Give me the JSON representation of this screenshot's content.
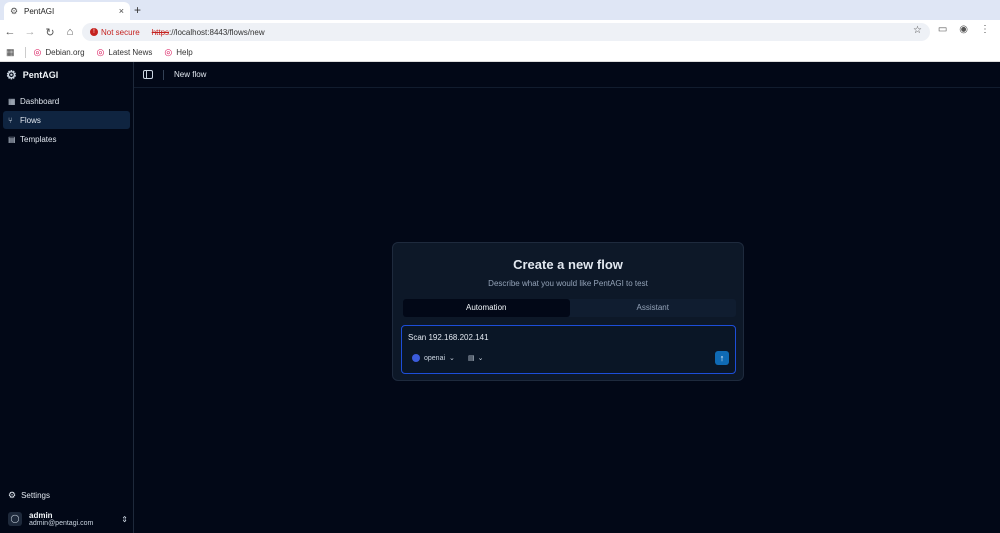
{
  "browser": {
    "tab_title": "PentAGI",
    "tab_close": "×",
    "new_tab": "+",
    "security_label": "Not secure",
    "url_scheme": "https",
    "url_rest": "://localhost:8443/flows/new",
    "bookmarks": [
      {
        "label": "Debian.org"
      },
      {
        "label": "Latest News"
      },
      {
        "label": "Help"
      }
    ]
  },
  "sidebar": {
    "brand": "PentAGI",
    "items": [
      {
        "label": "Dashboard",
        "icon": "dashboard-icon",
        "active": false
      },
      {
        "label": "Flows",
        "icon": "flows-icon",
        "active": true
      },
      {
        "label": "Templates",
        "icon": "document-icon",
        "active": false
      }
    ],
    "settings_label": "Settings",
    "user": {
      "name": "admin",
      "email": "admin@pentagi.com"
    }
  },
  "topbar": {
    "breadcrumb": "New flow"
  },
  "card": {
    "title": "Create a new flow",
    "subtitle": "Describe what you would like PentAGI to test",
    "tabs": [
      {
        "label": "Automation",
        "active": true
      },
      {
        "label": "Assistant",
        "active": false
      }
    ],
    "input_value": "Scan 192.168.202.141",
    "provider": "openai",
    "send_icon": "arrow-up-icon"
  },
  "colors": {
    "accent": "#0f6ab4",
    "active_nav": "#0f2440",
    "background": "#020817"
  }
}
